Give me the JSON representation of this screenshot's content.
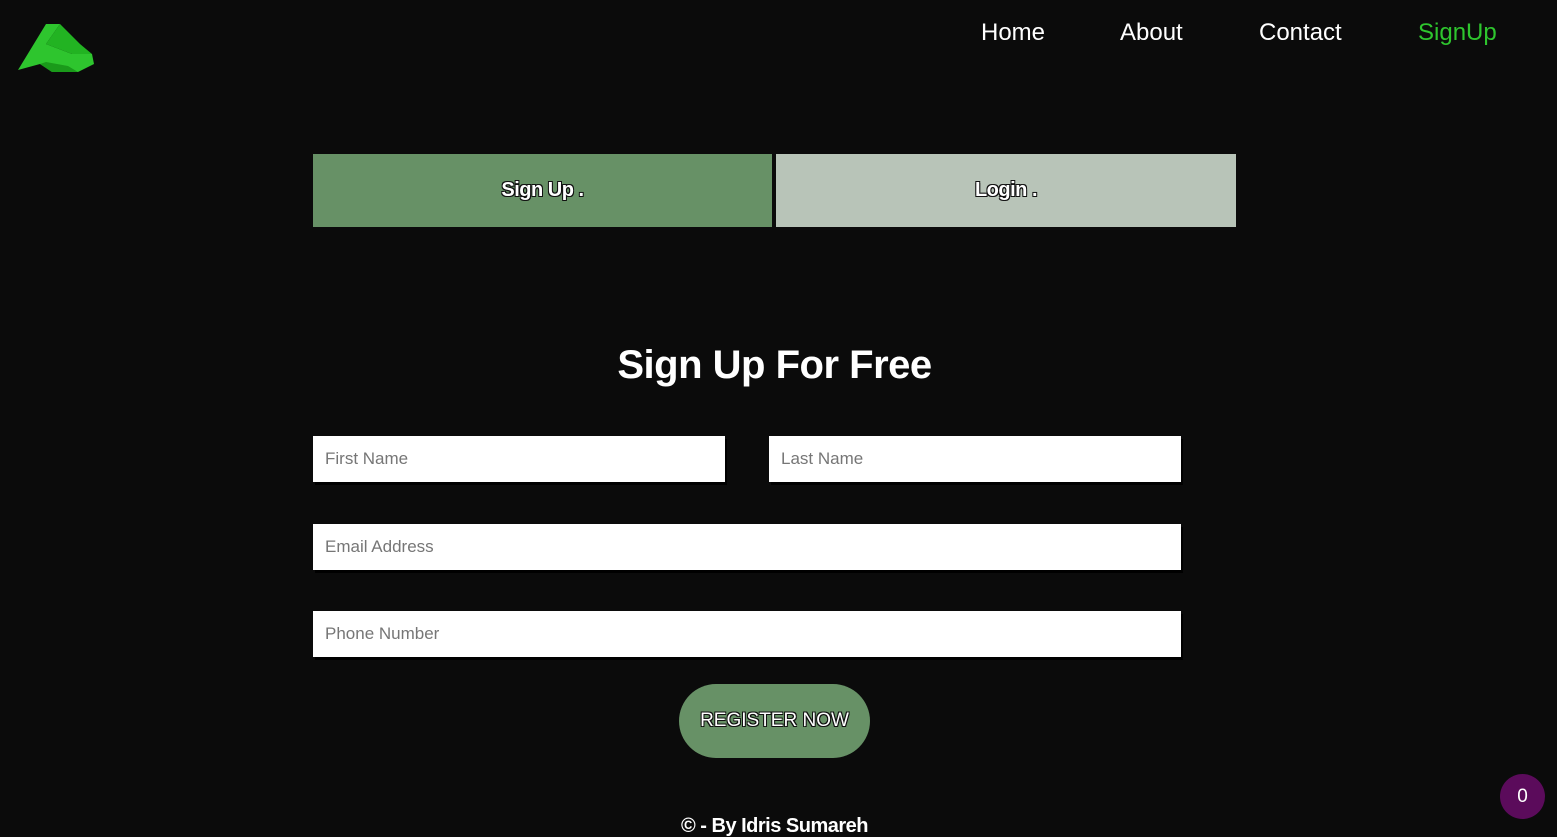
{
  "brand": {
    "logo_icon": "green-peak-logo-icon",
    "color": "#2ec52e"
  },
  "nav": {
    "items": [
      {
        "label": "Home"
      },
      {
        "label": "About"
      },
      {
        "label": "Contact"
      },
      {
        "label": "SignUp",
        "active": true
      }
    ]
  },
  "tabs": {
    "signup_label": "Sign Up .",
    "login_label": "Login .",
    "active_color": "#679166",
    "inactive_color": "#b8c4b8"
  },
  "form": {
    "title": "Sign Up For Free",
    "first_name_placeholder": "First Name",
    "last_name_placeholder": "Last Name",
    "email_placeholder": "Email Address",
    "phone_placeholder": "Phone Number",
    "submit_label": "REGISTER NOW"
  },
  "footer": {
    "text": "© - By Idris Sumareh"
  },
  "badge": {
    "count": "0",
    "color": "#5b0b5b"
  }
}
